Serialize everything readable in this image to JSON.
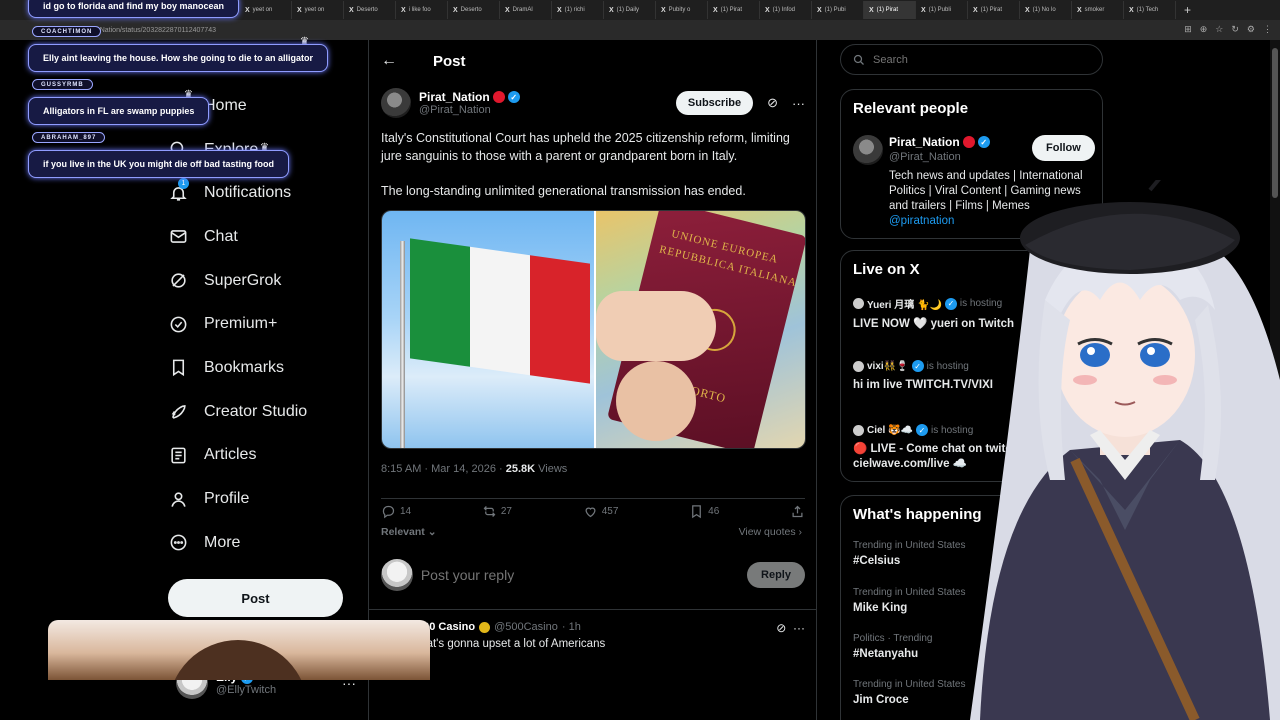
{
  "browser": {
    "tabs": [
      "yeet on",
      "yeet on",
      "Deserto",
      "i like foo",
      "Deserto",
      "DramAl",
      "(1) richi",
      "(1) Daily",
      "Pubity o",
      "(1) Pirat",
      "(1) Infod",
      "(1) Pubi",
      "(1) Pirat",
      "(1) Publi",
      "(1) Pirat",
      "(1) No lo",
      "smoker",
      "(1) Tech"
    ],
    "active_tab_index": 12,
    "url": "at_Nation/status/2032822870112407743"
  },
  "chat": [
    {
      "user": "",
      "text": "id go to florida and find my boy manocean"
    },
    {
      "user": "COACHTIMON",
      "text": "Elly aint leaving the house. How she going to die to an alligator"
    },
    {
      "user": "GUSSYRMB",
      "text": "Alligators in FL are swamp puppies"
    },
    {
      "user": "ABRAHAM_897",
      "text": "if you live in the UK you might die off bad tasting food"
    }
  ],
  "nav": {
    "items": [
      {
        "label": "Home",
        "icon": "home-icon"
      },
      {
        "label": "Explore",
        "icon": "search-icon"
      },
      {
        "label": "Notifications",
        "icon": "bell-icon",
        "badge": "1"
      },
      {
        "label": "Chat",
        "icon": "mail-icon"
      },
      {
        "label": "SuperGrok",
        "icon": "grok-icon"
      },
      {
        "label": "Premium+",
        "icon": "premium-icon"
      },
      {
        "label": "Bookmarks",
        "icon": "bookmark-icon"
      },
      {
        "label": "Creator Studio",
        "icon": "rocket-icon"
      },
      {
        "label": "Articles",
        "icon": "article-icon"
      },
      {
        "label": "Profile",
        "icon": "person-icon"
      },
      {
        "label": "More",
        "icon": "more-circle-icon"
      }
    ],
    "post_button": "Post",
    "me": {
      "name": "Elly",
      "handle": "@EllyTwitch"
    }
  },
  "post": {
    "header": "Post",
    "author_name": "Pirat_Nation",
    "author_handle": "@Pirat_Nation",
    "subscribe": "Subscribe",
    "text_1": "Italy's Constitutional Court has upheld the 2025 citizenship reform, limiting jure sanguinis to those with a parent or grandparent born in Italy.",
    "text_2": "The long-standing unlimited generational transmission has ended.",
    "media_passport_line_1": "UNIONE EUROPEA",
    "media_passport_line_2": "REPUBBLICA ITALIANA",
    "media_passport_line_3": "PASSAPORTO",
    "time": "8:15 AM · Mar 14, 2026 · ",
    "views": "25.8K",
    "views_label": " Views",
    "stats": {
      "replies": "14",
      "reposts": "27",
      "likes": "457",
      "bookmarks": "46"
    },
    "sort": "Relevant",
    "view_quotes": "View quotes",
    "reply_placeholder": "Post your reply",
    "reply_button": "Reply"
  },
  "reply": {
    "avatar_text": "500",
    "name": "500 Casino",
    "handle": "@500Casino",
    "time": "· 1h",
    "text": "that's gonna upset a lot of Americans"
  },
  "sidebar": {
    "search_placeholder": "Search",
    "relevant_title": "Relevant people",
    "person": {
      "name": "Pirat_Nation",
      "handle": "@Pirat_Nation",
      "follow": "Follow",
      "bio": "Tech news and updates | International Politics | Viral Content | Gaming news and trailers | Films | Memes",
      "link": "@piratnation"
    },
    "live_title": "Live on X",
    "live": [
      {
        "user": "Yueri 月璃 🐈🌙",
        "status": "is hosting",
        "title": "LIVE NOW 🤍 yueri on Twitch"
      },
      {
        "user": "vixi👯‍♀️🍷",
        "status": "is hosting",
        "title": "hi im live TWITCH.TV/VIXI"
      },
      {
        "user": "Ciel 🐯☁️",
        "status": "is hosting",
        "title": "🔴 LIVE - Come chat on twitch 🐯 cielwave.com/live ☁️"
      }
    ],
    "happening_title": "What's happening",
    "trends": [
      {
        "context": "Trending in United States",
        "name": "#Celsius"
      },
      {
        "context": "Trending in United States",
        "name": "Mike King"
      },
      {
        "context": "Politics · Trending",
        "name": "#Netanyahu"
      },
      {
        "context": "Trending in United States",
        "name": "Jim Croce"
      }
    ]
  },
  "colors": {
    "accent": "#1d9bf0",
    "background": "#000000",
    "border": "#2f3336",
    "muted": "#71767b"
  }
}
